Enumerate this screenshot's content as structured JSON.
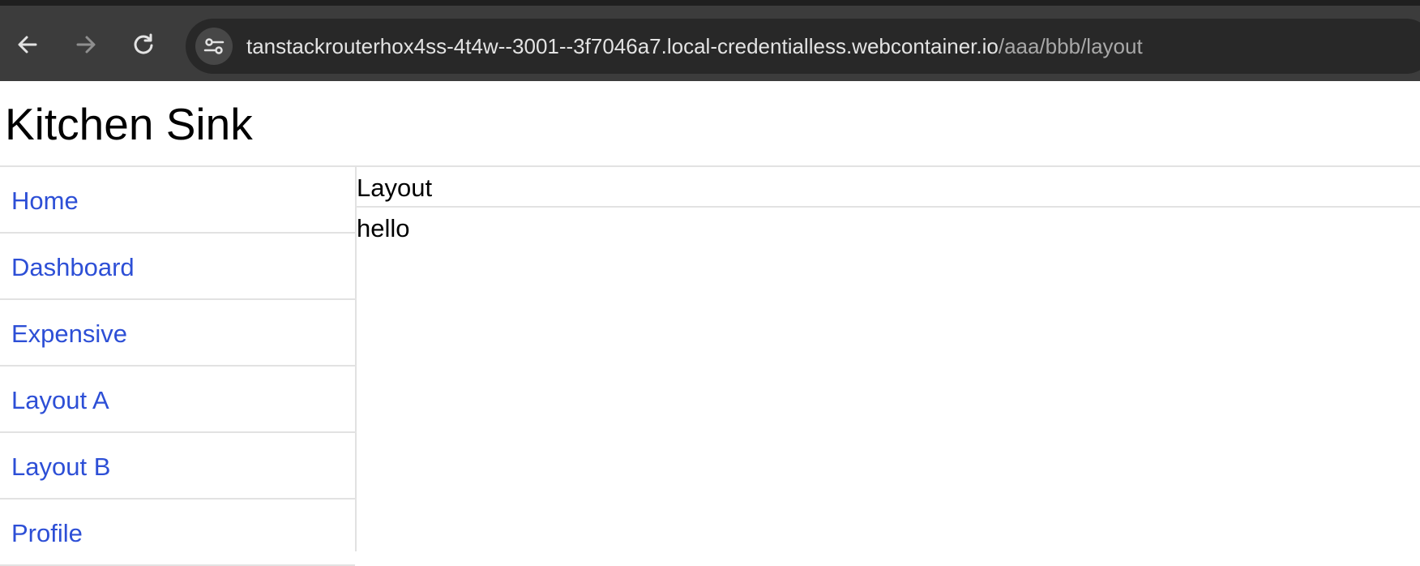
{
  "browser": {
    "url_host": "tanstackrouterhox4ss-4t4w--3001--3f7046a7.local-credentialless.webcontainer.io",
    "url_path": "/aaa/bbb/layout",
    "icons": {
      "back": "arrow-left",
      "forward": "arrow-right",
      "reload": "reload",
      "site_info": "tune-sliders"
    }
  },
  "app": {
    "title": "Kitchen Sink"
  },
  "sidebar": {
    "items": [
      {
        "label": "Home"
      },
      {
        "label": "Dashboard"
      },
      {
        "label": "Expensive"
      },
      {
        "label": "Layout A"
      },
      {
        "label": "Layout B"
      },
      {
        "label": "Profile"
      }
    ]
  },
  "main": {
    "heading": "Layout",
    "body": "hello"
  },
  "colors": {
    "link": "#2d4fd6",
    "toolbar": "#3c3c3c",
    "omnibox": "#282828"
  }
}
